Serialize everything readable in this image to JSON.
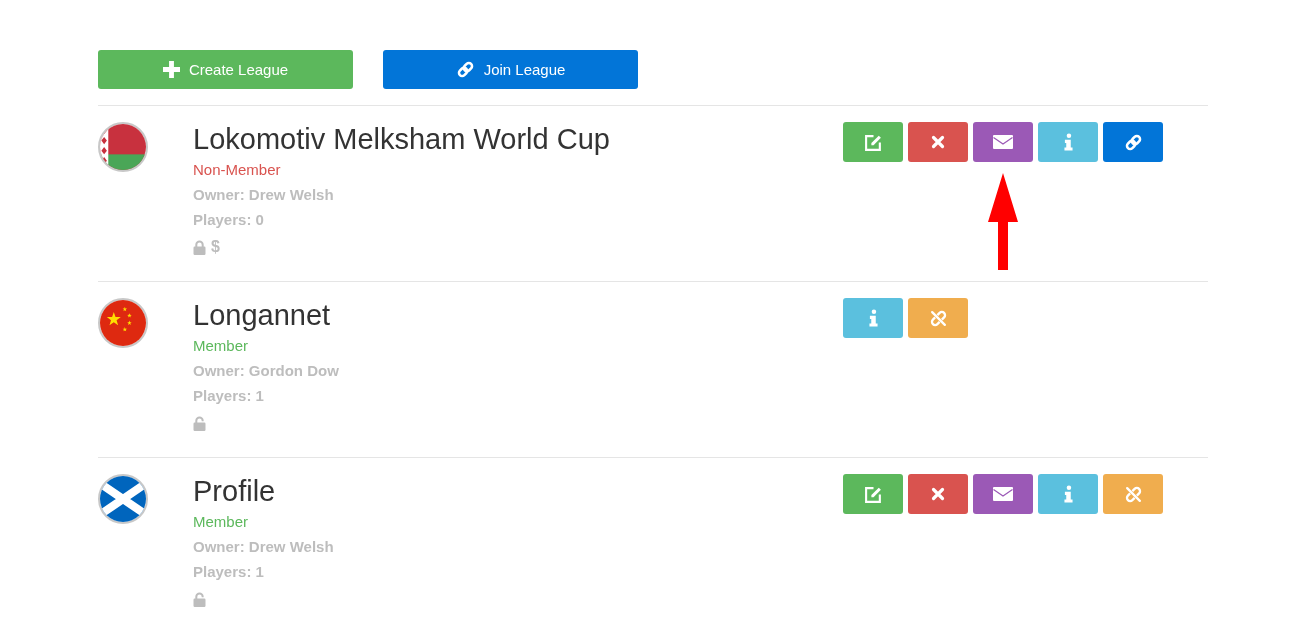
{
  "toolbar": {
    "buttons": [
      {
        "kind": "create",
        "label": "Create League"
      },
      {
        "kind": "join",
        "label": "Join League"
      }
    ]
  },
  "leagues": [
    {
      "flag": {
        "kind": "belarus"
      },
      "name": "Lokomotiv Melksham World Cup",
      "member": false,
      "status": "Non-Member",
      "owner": "Owner: Drew Welsh",
      "players": "Players: 0",
      "locked": true,
      "price_symbol": "$",
      "actions": [
        {
          "kind": "edit",
          "pointed_at": false
        },
        {
          "kind": "delete",
          "pointed_at": false
        },
        {
          "kind": "message",
          "pointed_at": true
        },
        {
          "kind": "info",
          "pointed_at": false
        },
        {
          "kind": "join",
          "pointed_at": false
        }
      ]
    },
    {
      "flag": {
        "kind": "china"
      },
      "name": "Longannet",
      "member": true,
      "status": "Member",
      "owner": "Owner: Gordon Dow",
      "players": "Players: 1",
      "locked": false,
      "actions": [
        {
          "kind": "info",
          "pointed_at": false
        },
        {
          "kind": "leave",
          "pointed_at": false
        }
      ]
    },
    {
      "flag": {
        "kind": "scotland"
      },
      "name": "Profile",
      "member": true,
      "status": "Member",
      "owner": "Owner: Drew Welsh",
      "players": "Players: 1",
      "locked": false,
      "actions": [
        {
          "kind": "edit",
          "pointed_at": false
        },
        {
          "kind": "delete",
          "pointed_at": false
        },
        {
          "kind": "message",
          "pointed_at": false
        },
        {
          "kind": "info",
          "pointed_at": false
        },
        {
          "kind": "leave",
          "pointed_at": false
        }
      ]
    }
  ]
}
